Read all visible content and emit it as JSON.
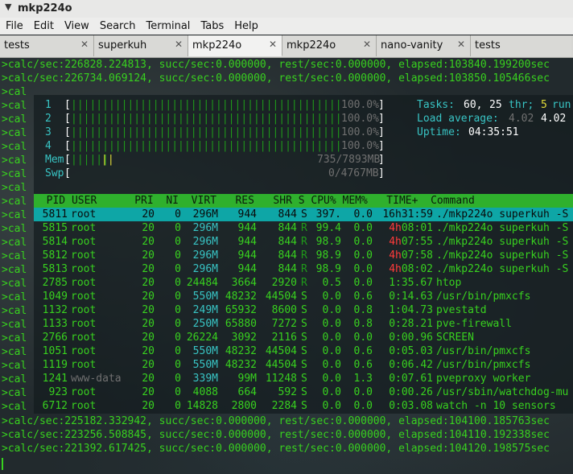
{
  "window": {
    "title": "mkp224o"
  },
  "menu": [
    "File",
    "Edit",
    "View",
    "Search",
    "Terminal",
    "Tabs",
    "Help"
  ],
  "tabs": [
    {
      "label": "tests",
      "active": false
    },
    {
      "label": "superkuh",
      "active": false
    },
    {
      "label": "mkp224o",
      "active": true
    },
    {
      "label": "mkp224o",
      "active": false
    },
    {
      "label": "nano-vanity",
      "active": false
    },
    {
      "label": "tests",
      "active": false
    }
  ],
  "terminal": {
    "top_lines": [
      ">calc/sec:226828.224813, succ/sec:0.000000, rest/sec:0.000000, elapsed:103840.199200sec",
      ">calc/sec:226734.069124, succ/sec:0.000000, rest/sec:0.000000, elapsed:103850.105466sec"
    ],
    "left_prefix": ">cal",
    "bottom_lines": [
      ">calc/sec:225182.332942, succ/sec:0.000000, rest/sec:0.000000, elapsed:104100.185763sec",
      ">calc/sec:223256.508845, succ/sec:0.000000, rest/sec:0.000000, elapsed:104110.192338sec",
      ">calc/sec:221392.617425, succ/sec:0.000000, rest/sec:0.000000, elapsed:104120.198575sec"
    ]
  },
  "htop": {
    "cpus": [
      {
        "label": "1",
        "pct": "100.0%"
      },
      {
        "label": "2",
        "pct": "100.0%"
      },
      {
        "label": "3",
        "pct": "100.0%"
      },
      {
        "label": "4",
        "pct": "100.0%"
      }
    ],
    "mem": {
      "label": "Mem",
      "value": "735/7893MB"
    },
    "swp": {
      "label": "Swp",
      "value": "0/4767MB"
    },
    "tasks": {
      "label": "Tasks:",
      "count": "60,",
      "thr": "25",
      "thr_label": "thr;",
      "running": "5",
      "running_label": "run"
    },
    "load": {
      "label": "Load average:",
      "v1": "4.02",
      "v2": "4.02"
    },
    "uptime": {
      "label": "Uptime:",
      "value": "04:35:51"
    },
    "header": "  PID USER      PRI  NI  VIRT   RES   SHR S CPU% MEM%   TIME+  Command",
    "processes": [
      {
        "pid": "5811",
        "user": "root",
        "pri": "20",
        "ni": "0",
        "virt": "296M",
        "res": "944",
        "shr": "844",
        "s": "S",
        "cpu": "397.",
        "mem": "0.0",
        "time_h": "16h",
        "time_r": "31:59",
        "cmd": "./mkp224o superkuh -S"
      },
      {
        "pid": "5815",
        "user": "root",
        "pri": "20",
        "ni": "0",
        "virt": "296M",
        "res": "944",
        "shr": "844",
        "s": "R",
        "cpu": "99.4",
        "mem": "0.0",
        "time_h": "4h",
        "time_r": "08:01",
        "cmd": "./mkp224o superkuh -S"
      },
      {
        "pid": "5814",
        "user": "root",
        "pri": "20",
        "ni": "0",
        "virt": "296M",
        "res": "944",
        "shr": "844",
        "s": "R",
        "cpu": "98.9",
        "mem": "0.0",
        "time_h": "4h",
        "time_r": "07:55",
        "cmd": "./mkp224o superkuh -S"
      },
      {
        "pid": "5812",
        "user": "root",
        "pri": "20",
        "ni": "0",
        "virt": "296M",
        "res": "944",
        "shr": "844",
        "s": "R",
        "cpu": "98.9",
        "mem": "0.0",
        "time_h": "4h",
        "time_r": "07:58",
        "cmd": "./mkp224o superkuh -S"
      },
      {
        "pid": "5813",
        "user": "root",
        "pri": "20",
        "ni": "0",
        "virt": "296M",
        "res": "944",
        "shr": "844",
        "s": "R",
        "cpu": "98.9",
        "mem": "0.0",
        "time_h": "4h",
        "time_r": "08:02",
        "cmd": "./mkp224o superkuh -S"
      },
      {
        "pid": "2785",
        "user": "root",
        "pri": "20",
        "ni": "0",
        "virt": "24484",
        "res": "3664",
        "shr": "2920",
        "s": "R",
        "cpu": "0.5",
        "mem": "0.0",
        "time_h": "",
        "time_r": "1:35.67",
        "cmd": "htop"
      },
      {
        "pid": "1049",
        "user": "root",
        "pri": "20",
        "ni": "0",
        "virt": "550M",
        "res": "48232",
        "shr": "44504",
        "s": "S",
        "cpu": "0.0",
        "mem": "0.6",
        "time_h": "",
        "time_r": "0:14.63",
        "cmd": "/usr/bin/pmxcfs"
      },
      {
        "pid": "1132",
        "user": "root",
        "pri": "20",
        "ni": "0",
        "virt": "249M",
        "res": "65932",
        "shr": "8600",
        "s": "S",
        "cpu": "0.0",
        "mem": "0.8",
        "time_h": "",
        "time_r": "1:04.73",
        "cmd": "pvestatd"
      },
      {
        "pid": "1133",
        "user": "root",
        "pri": "20",
        "ni": "0",
        "virt": "250M",
        "res": "65880",
        "shr": "7272",
        "s": "S",
        "cpu": "0.0",
        "mem": "0.8",
        "time_h": "",
        "time_r": "0:28.21",
        "cmd": "pve-firewall"
      },
      {
        "pid": "2766",
        "user": "root",
        "pri": "20",
        "ni": "0",
        "virt": "26224",
        "res": "3092",
        "shr": "2116",
        "s": "S",
        "cpu": "0.0",
        "mem": "0.0",
        "time_h": "",
        "time_r": "0:00.96",
        "cmd": "SCREEN"
      },
      {
        "pid": "1051",
        "user": "root",
        "pri": "20",
        "ni": "0",
        "virt": "550M",
        "res": "48232",
        "shr": "44504",
        "s": "S",
        "cpu": "0.0",
        "mem": "0.6",
        "time_h": "",
        "time_r": "0:05.03",
        "cmd": "/usr/bin/pmxcfs"
      },
      {
        "pid": "1119",
        "user": "root",
        "pri": "20",
        "ni": "0",
        "virt": "550M",
        "res": "48232",
        "shr": "44504",
        "s": "S",
        "cpu": "0.0",
        "mem": "0.6",
        "time_h": "",
        "time_r": "0:06.42",
        "cmd": "/usr/bin/pmxcfs"
      },
      {
        "pid": "1241",
        "user": "www-data",
        "pri": "20",
        "ni": "0",
        "virt": "339M",
        "res": "99M",
        "shr": "11248",
        "s": "S",
        "cpu": "0.0",
        "mem": "1.3",
        "time_h": "",
        "time_r": "0:07.61",
        "cmd": "pveproxy worker"
      },
      {
        "pid": "923",
        "user": "root",
        "pri": "20",
        "ni": "0",
        "virt": "4088",
        "res": "664",
        "shr": "592",
        "s": "S",
        "cpu": "0.0",
        "mem": "0.0",
        "time_h": "",
        "time_r": "0:00.26",
        "cmd": "/usr/sbin/watchdog-mu"
      },
      {
        "pid": "6712",
        "user": "root",
        "pri": "20",
        "ni": "0",
        "virt": "14828",
        "res": "2800",
        "shr": "2284",
        "s": "S",
        "cpu": "0.0",
        "mem": "0.0",
        "time_h": "",
        "time_r": "0:03.08",
        "cmd": "watch -n 10 sensors"
      }
    ]
  },
  "colors": {
    "accent_green": "#38d11f",
    "selection_cyan": "#0ea6a6",
    "header_green": "#2fb02d",
    "time_red": "#ff3b3b"
  },
  "icons": {
    "tab_close": "close-icon",
    "window_menu": "chevron-down-icon"
  }
}
